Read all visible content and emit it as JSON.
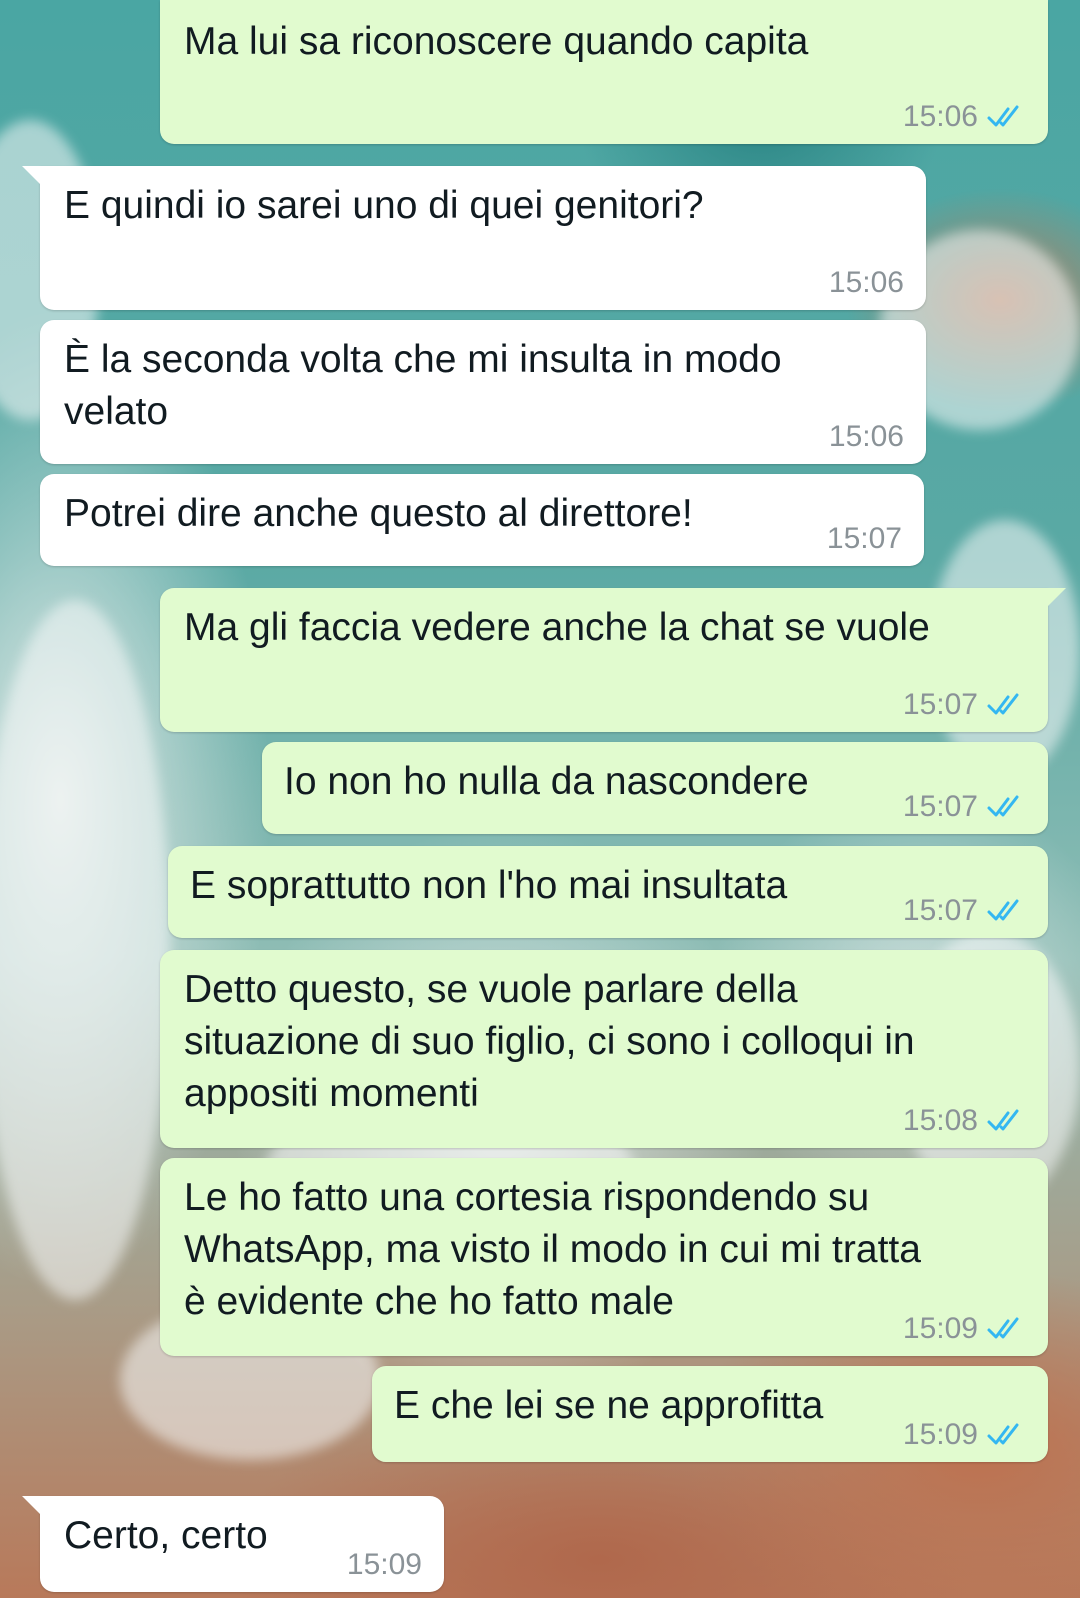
{
  "chat": {
    "messages": [
      {
        "text": "Ma lui sa riconoscere quando capita",
        "time": "15:06",
        "direction": "out",
        "status_icon": "double-check-read-icon"
      },
      {
        "text": "E quindi io sarei uno di quei genitori?",
        "time": "15:06",
        "direction": "in"
      },
      {
        "text": "È la seconda volta che mi insulta in modo\nvelato",
        "time": "15:06",
        "direction": "in"
      },
      {
        "text": "Potrei dire anche questo al direttore!",
        "time": "15:07",
        "direction": "in"
      },
      {
        "text": "Ma gli faccia vedere anche la chat se vuole",
        "time": "15:07",
        "direction": "out",
        "status_icon": "double-check-read-icon"
      },
      {
        "text": "Io non ho nulla da nascondere",
        "time": "15:07",
        "direction": "out",
        "status_icon": "double-check-read-icon"
      },
      {
        "text": "E soprattutto non l'ho mai insultata",
        "time": "15:07",
        "direction": "out",
        "status_icon": "double-check-read-icon"
      },
      {
        "text": "Detto questo, se vuole parlare della\nsituazione di suo figlio, ci sono i colloqui in\nappositi momenti",
        "time": "15:08",
        "direction": "out",
        "status_icon": "double-check-read-icon"
      },
      {
        "text": "Le ho fatto una cortesia rispondendo su\nWhatsApp, ma visto il modo in cui mi tratta\nè evidente che ho fatto male",
        "time": "15:09",
        "direction": "out",
        "status_icon": "double-check-read-icon"
      },
      {
        "text": "E che lei se ne approfitta",
        "time": "15:09",
        "direction": "out",
        "status_icon": "double-check-read-icon"
      },
      {
        "text": "Certo, certo",
        "time": "15:09",
        "direction": "in"
      }
    ]
  },
  "colors": {
    "outgoing_bubble": "#e1fbcf",
    "incoming_bubble": "#ffffff",
    "read_ticks": "#34b7f1",
    "timestamp": "#8a9297"
  }
}
